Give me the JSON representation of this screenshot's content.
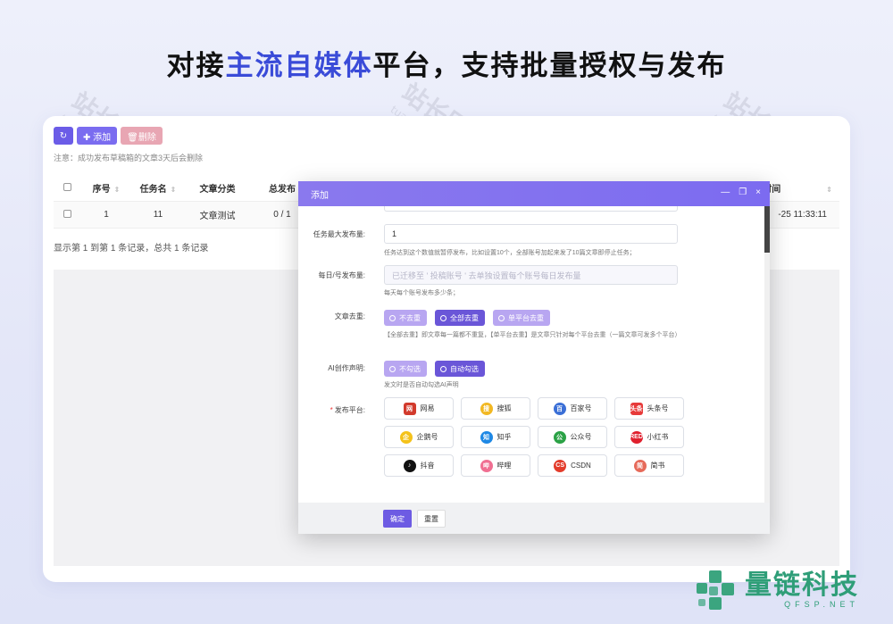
{
  "headline": {
    "part1": "对接",
    "highlight": "主流自媒体",
    "part2": "平台，支持批量授权与发布"
  },
  "watermark": {
    "text": "站长团购",
    "url": "tuan.chinaz.com"
  },
  "toolbar": {
    "refresh_icon": "↻",
    "add_label": "✚ 添加",
    "delete_label": "🗑删除"
  },
  "notice": "注意：成功发布草稿箱的文章3天后会删除",
  "table": {
    "headers": [
      "序号",
      "任务名",
      "文章分类",
      "总发布",
      "建时间"
    ],
    "rows": [
      {
        "no": "1",
        "task": "11",
        "category": "文章测试",
        "total": "0 / 1",
        "time": "-25 11:33:11"
      }
    ]
  },
  "summary": "显示第 1 到第 1 条记录，总共 1 条记录",
  "modal": {
    "title": "添加",
    "controls": {
      "minimize": "—",
      "maximize": "❐",
      "close": "×"
    },
    "max_publish": {
      "label": "任务最大发布量:",
      "value": "1",
      "help": "任务达到这个数值就暂停发布，比如设置10个，全部账号加起来发了10篇文章即停止任务；"
    },
    "daily_publish": {
      "label": "每日/号发布量:",
      "placeholder": "已迁移至 ' 投稿账号 ' 去单独设置每个账号每日发布量",
      "help": "每天每个账号发布多少条；"
    },
    "dedupe": {
      "label": "文章去重:",
      "options": [
        "不去重",
        "全部去重",
        "单平台去重"
      ],
      "selected": "全部去重",
      "help": "【全部去重】即文章每一篇都不重复，【单平台去重】是文章只针对每个平台去重（一篇文章可发多个平台）"
    },
    "ai_declare": {
      "label": "AI创作声明:",
      "options": [
        "不勾选",
        "自动勾选"
      ],
      "selected": "自动勾选",
      "help": "发文时是否自动勾选AI声明"
    },
    "platforms": {
      "label": "发布平台:",
      "items": [
        {
          "name": "网易",
          "icon": "网",
          "color": "#d23a2c"
        },
        {
          "name": "搜狐",
          "icon": "搜",
          "color": "#f2b823"
        },
        {
          "name": "百家号",
          "icon": "百",
          "color": "#3b6fd6"
        },
        {
          "name": "头条号",
          "icon": "头条",
          "color": "#e73a3a"
        },
        {
          "name": "企鹅号",
          "icon": "企",
          "color": "#f4c21b"
        },
        {
          "name": "知乎",
          "icon": "知",
          "color": "#1e88e5"
        },
        {
          "name": "公众号",
          "icon": "公",
          "color": "#2ba246"
        },
        {
          "name": "小红书",
          "icon": "RED",
          "color": "#e0202e"
        },
        {
          "name": "抖音",
          "icon": "♪",
          "color": "#111111"
        },
        {
          "name": "哔哩",
          "icon": "哔",
          "color": "#f06f92"
        },
        {
          "name": "CSDN",
          "icon": "CS",
          "color": "#e33c2b"
        },
        {
          "name": "简书",
          "icon": "简",
          "color": "#e66a5a"
        }
      ]
    },
    "confirm_label": "确定",
    "reset_label": "重置"
  },
  "brand": {
    "name": "量链科技",
    "url": "QFSP.NET"
  }
}
